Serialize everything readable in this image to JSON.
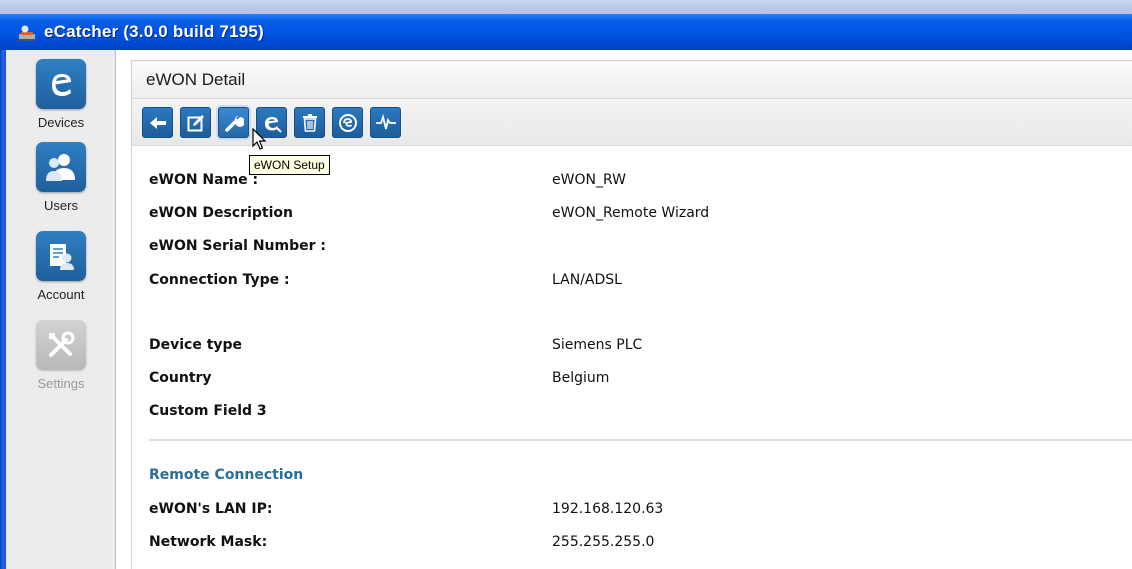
{
  "window": {
    "title": "eCatcher  (3.0.0 build 7195)"
  },
  "sidebar": {
    "items": [
      {
        "label": "Devices",
        "icon": "devices-e-icon",
        "enabled": true
      },
      {
        "label": "Users",
        "icon": "users-icon",
        "enabled": true
      },
      {
        "label": "Account",
        "icon": "account-icon",
        "enabled": true
      },
      {
        "label": "Settings",
        "icon": "settings-tools-icon",
        "enabled": false
      }
    ]
  },
  "panel": {
    "title": "eWON Detail",
    "toolbar": [
      {
        "icon": "back-arrow-icon"
      },
      {
        "icon": "edit-icon"
      },
      {
        "icon": "wrench-setup-icon"
      },
      {
        "icon": "connect-link-icon"
      },
      {
        "icon": "trash-icon"
      },
      {
        "icon": "disconnect-icon"
      },
      {
        "icon": "pulse-monitor-icon"
      }
    ],
    "tooltip": "eWON Setup",
    "fields": [
      {
        "label": "eWON Name :",
        "value": "eWON_RW"
      },
      {
        "label": "eWON Description",
        "value": "eWON_Remote Wizard"
      },
      {
        "label": "eWON Serial Number :",
        "value": ""
      },
      {
        "label": "Connection Type :",
        "value": "LAN/ADSL"
      },
      {
        "label": "Device type",
        "value": "Siemens PLC"
      },
      {
        "label": "Country",
        "value": "Belgium"
      },
      {
        "label": "Custom Field 3",
        "value": ""
      }
    ],
    "remote": {
      "title": "Remote Connection",
      "fields": [
        {
          "label": "eWON's LAN IP:",
          "value": "192.168.120.63"
        },
        {
          "label": "Network Mask:",
          "value": "255.255.255.0"
        }
      ]
    }
  },
  "colors": {
    "titlebar": "#0054e3",
    "nav_tile": "#2f7fc3",
    "toolbar_button": "#2c7ac0",
    "section_title": "#2a6e9a"
  }
}
